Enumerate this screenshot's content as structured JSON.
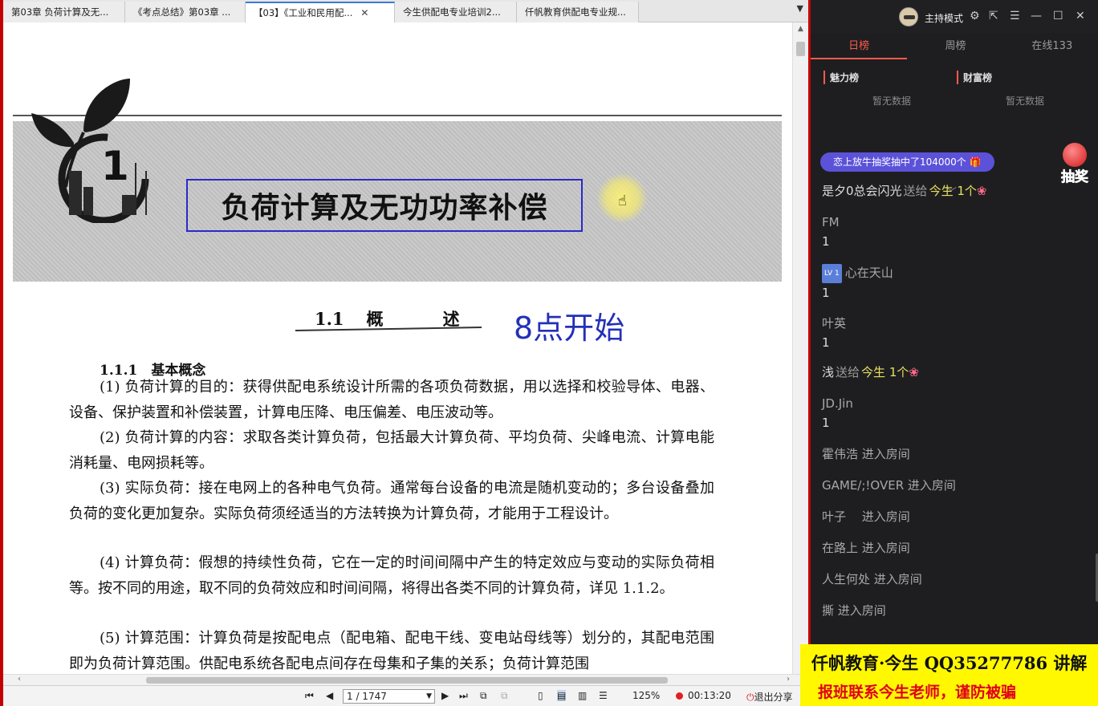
{
  "tabs": [
    {
      "label": "第03章 负荷计算及无...",
      "active": false
    },
    {
      "label": "《考点总结》第03章 ...",
      "active": false
    },
    {
      "label": "【03】《工业和民用配...",
      "active": true
    },
    {
      "label": "今生供配电专业培训2...",
      "active": false
    },
    {
      "label": "仟帆教育供配电专业规...",
      "active": false
    }
  ],
  "tab_close_glyph": "✕",
  "document": {
    "chapter_number": "1",
    "chapter_title": "负荷计算及无功功率补偿",
    "section_number": "1.1",
    "section_title_a": "概",
    "section_title_b": "述",
    "handwritten_note": "8点开始",
    "subheading": "1.1.1　基本概念",
    "paragraphs": [
      "(1) 负荷计算的目的：获得供配电系统设计所需的各项负荷数据，用以选择和校验导体、电器、设备、保护装置和补偿装置，计算电压降、电压偏差、电压波动等。",
      "(2) 负荷计算的内容：求取各类计算负荷，包括最大计算负荷、平均负荷、尖峰电流、计算电能消耗量、电网损耗等。",
      "(3) 实际负荷：接在电网上的各种电气负荷。通常每台设备的电流是随机变动的；多台设备叠加负荷的变化更加复杂。实际负荷须经适当的方法转换为计算负荷，才能用于工程设计。",
      "(4) 计算负荷：假想的持续性负荷，它在一定的时间间隔中产生的特定效应与变动的实际负荷相等。按不同的用途，取不同的负荷效应和时间间隔，将得出各类不同的计算负荷，详见 1.1.2。",
      "(5) 计算范围：计算负荷是按配电点（配电箱、配电干线、变电站母线等）划分的，其配电范围即为负荷计算范围。供配电系统各配电点间存在母集和子集的关系；负荷计算范围"
    ]
  },
  "statusbar": {
    "page_indicator": "1 / 1747",
    "zoom": "125%",
    "timer": "00:13:20",
    "exit_share": "退出分享"
  },
  "live": {
    "host_mode": "主持模式",
    "rank_tabs": [
      "日榜",
      "周榜",
      "在线133"
    ],
    "charm_title": "魅力榜",
    "wealth_title": "财富榜",
    "no_data": "暂无数据",
    "lottery_banner": "恋上放牛抽奖抽中了104000个",
    "draw_label": "抽奖",
    "messages": [
      {
        "user": "是夕0总会闪光",
        "sent": "送给",
        "target": "今生",
        "count": "1个"
      },
      {
        "user": "FM",
        "body": "1"
      },
      {
        "level": "LV 1",
        "user": "心在天山",
        "body": "1"
      },
      {
        "user": "叶英",
        "body": "1"
      },
      {
        "user": "浅",
        "sent": "送给",
        "target": "今生",
        "count": "1个"
      },
      {
        "user": "JD.Jin",
        "body": "1"
      },
      {
        "user": "霍伟浩",
        "enter": "进入房间"
      },
      {
        "user": "GAME/;!OVER",
        "enter": "进入房间"
      },
      {
        "user": "叶子",
        "enter": "进入房间"
      },
      {
        "user": "在路上",
        "enter": "进入房间"
      },
      {
        "user": "人生何处",
        "enter": "进入房间"
      },
      {
        "user": "撕",
        "enter": "进入房间"
      }
    ]
  },
  "promo": {
    "line1": "仟帆教育·今生 QQ35277786 讲解",
    "line2": "报班联系今生老师，谨防被骗"
  },
  "colors": {
    "accent_red": "#ff5a4e",
    "lottery": "#5b52d9",
    "promo_bg": "#fff800",
    "note_blue": "#2330b8"
  }
}
